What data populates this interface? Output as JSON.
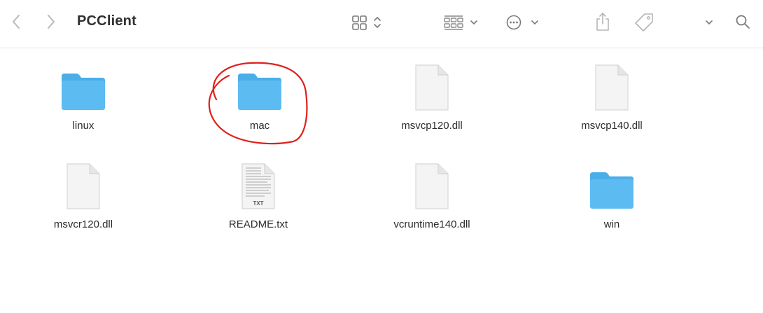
{
  "window": {
    "title": "PCClient"
  },
  "toolbar": {
    "icons": {
      "back": "chevron-left-icon",
      "forward": "chevron-right-icon",
      "view": "grid-view-icon",
      "group": "group-icon",
      "action": "ellipsis-circle-icon",
      "share": "share-icon",
      "tag": "tag-icon",
      "more": "chevron-down-icon",
      "search": "search-icon"
    }
  },
  "files": [
    {
      "name": "linux",
      "kind": "folder"
    },
    {
      "name": "mac",
      "kind": "folder",
      "annotated": true
    },
    {
      "name": "msvcp120.dll",
      "kind": "file"
    },
    {
      "name": "msvcp140.dll",
      "kind": "file"
    },
    {
      "name": "msvcr120.dll",
      "kind": "file"
    },
    {
      "name": "README.txt",
      "kind": "text",
      "badge": "TXT"
    },
    {
      "name": "vcruntime140.dll",
      "kind": "file"
    },
    {
      "name": "win",
      "kind": "folder"
    }
  ],
  "colors": {
    "folder_body": "#5cbcf2",
    "folder_tab": "#49aee9",
    "annotation": "#e0201b",
    "toolbar_icon": "#8a8a8a"
  }
}
